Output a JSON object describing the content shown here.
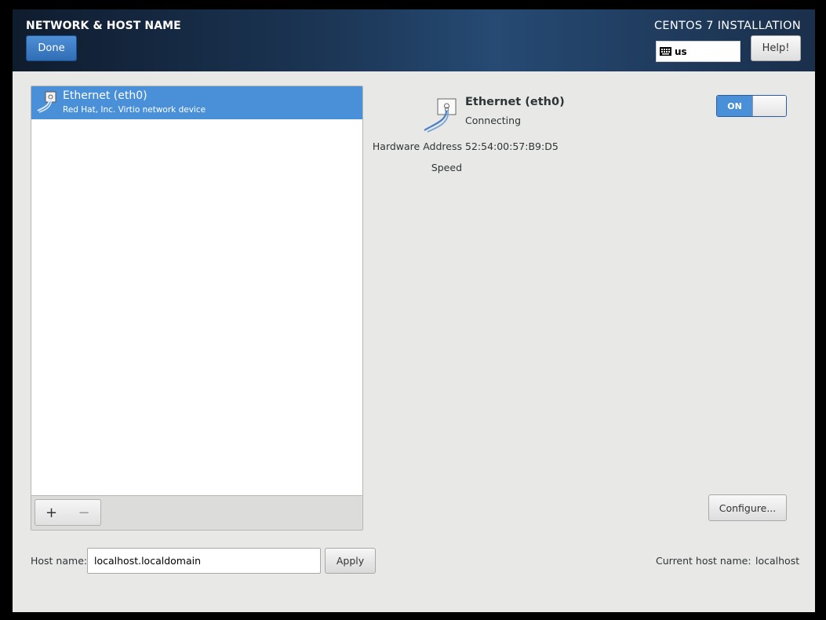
{
  "header": {
    "page_title": "NETWORK & HOST NAME",
    "done_label": "Done",
    "install_title": "CENTOS 7 INSTALLATION",
    "keyboard_layout": "us",
    "help_label": "Help!"
  },
  "devices": {
    "items": [
      {
        "name": "Ethernet (eth0)",
        "description": "Red Hat, Inc. Virtio network device",
        "selected": true
      }
    ],
    "add_label": "+",
    "remove_label": "−"
  },
  "details": {
    "name": "Ethernet (eth0)",
    "status": "Connecting",
    "hardware_address_label": "Hardware Address",
    "hardware_address": "52:54:00:57:B9:D5",
    "speed_label": "Speed",
    "toggle_label": "ON",
    "configure_label": "Configure..."
  },
  "hostname": {
    "label": "Host name:",
    "value": "localhost.localdomain",
    "apply_label": "Apply",
    "current_label": "Current host name:",
    "current_value": "localhost"
  },
  "colors": {
    "accent": "#4a90d9",
    "header_dark": "#1c3656",
    "background": "#e8e8e7"
  }
}
